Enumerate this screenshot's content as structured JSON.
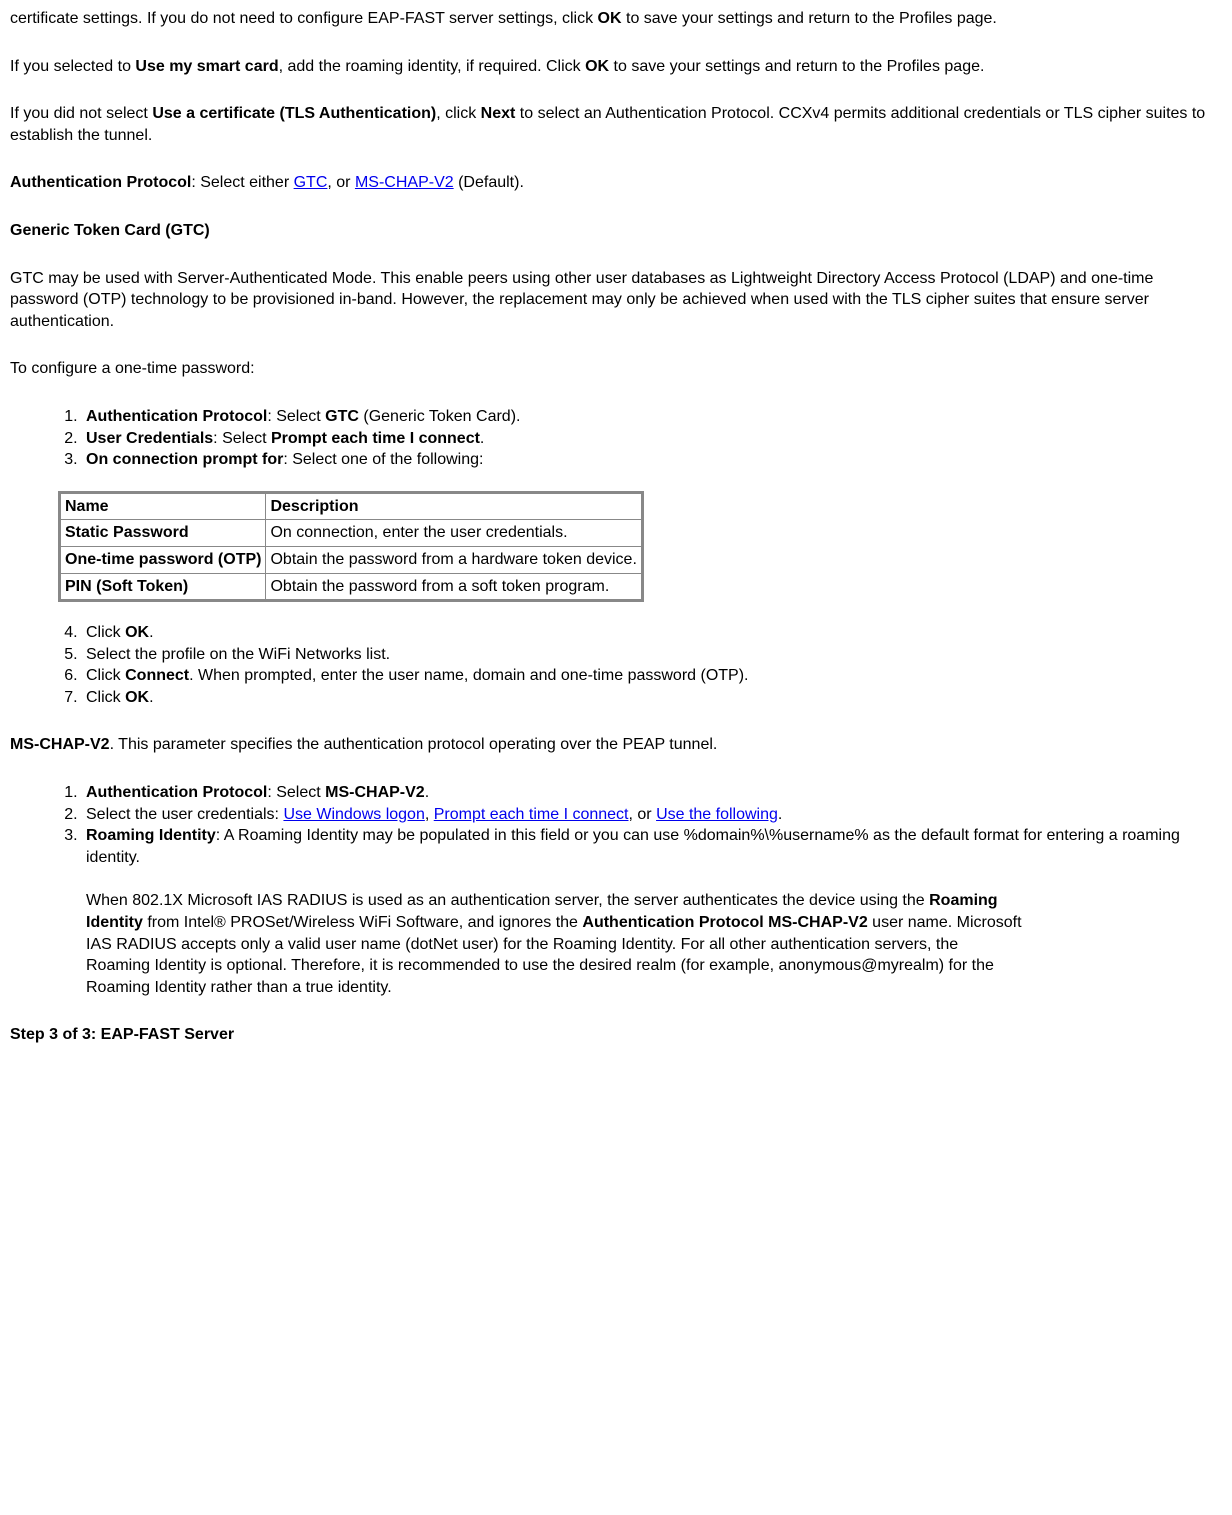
{
  "p1a": "certificate settings. If you do not need to configure EAP-FAST server settings, click ",
  "p1b": "OK",
  "p1c": " to save your settings and return to the Profiles page.",
  "p2a": "If you selected to ",
  "p2b": "Use my smart card",
  "p2c": ", add the roaming identity, if required. Click ",
  "p2d": "OK",
  "p2e": " to save your settings and return to the Profiles page.",
  "p3a": "If you did not select ",
  "p3b": "Use a certificate (TLS Authentication)",
  "p3c": ", click ",
  "p3d": "Next",
  "p3e": " to select an Authentication Protocol. CCXv4 permits additional credentials or TLS cipher suites to establish the tunnel.",
  "p4a": "Authentication Protocol",
  "p4b": ": Select either ",
  "p4_link1": "GTC",
  "p4c": ", or ",
  "p4_link2": "MS-CHAP-V2",
  "p4d": " (Default).",
  "h_gtc": "Generic Token Card (GTC)",
  "p5": "GTC may be used with Server-Authenticated Mode. This enable peers using other user databases as Lightweight Directory Access Protocol (LDAP) and one-time password (OTP) technology to be provisioned in-band. However, the replacement may only be achieved when used with the TLS cipher suites that ensure server authentication.",
  "p6": "To configure a one-time password:",
  "ol1": {
    "i1a": "Authentication Protocol",
    "i1b": ": Select ",
    "i1c": "GTC",
    "i1d": " (Generic Token Card).",
    "i2a": "User Credentials",
    "i2b": ": Select ",
    "i2c": "Prompt each time I connect",
    "i2d": ".",
    "i3a": "On connection prompt for",
    "i3b": ": Select one of the following:"
  },
  "table": {
    "h1": "Name",
    "h2": "Description",
    "r1c1": "Static Password",
    "r1c2": "On connection, enter the user credentials.",
    "r2c1": "One-time password (OTP)",
    "r2c2": "Obtain the password from a hardware token device.",
    "r3c1": "PIN (Soft Token)",
    "r3c2": "Obtain the password from a soft token program."
  },
  "ol2": {
    "i4a": "Click ",
    "i4b": "OK",
    "i4c": ".",
    "i5": "Select the profile on the WiFi Networks list.",
    "i6a": "Click ",
    "i6b": "Connect",
    "i6c": ". When prompted, enter the user name, domain and one-time password (OTP).",
    "i7a": "Click ",
    "i7b": "OK",
    "i7c": "."
  },
  "p7a": "MS-CHAP-V2",
  "p7b": ". This parameter specifies the authentication protocol operating over the PEAP tunnel.",
  "ol3": {
    "i1a": "Authentication Protocol",
    "i1b": ": Select ",
    "i1c": "MS-CHAP-V2",
    "i1d": ".",
    "i2a": "Select the user credentials: ",
    "i2_l1": "Use Windows logon",
    "i2b": ", ",
    "i2_l2": "Prompt each time I connect",
    "i2c": ", or ",
    "i2_l3": "Use the following",
    "i2d": ".",
    "i3a": "Roaming Identity",
    "i3b": ": A Roaming Identity may be populated in this field or you can use %domain%\\%username% as the default format for entering a roaming identity.",
    "i3p_a": "When 802.1X Microsoft IAS RADIUS is used as an authentication server, the server authenticates the device using the ",
    "i3p_b": "Roaming Identity",
    "i3p_c": " from Intel® PROSet/Wireless WiFi Software, and ignores the ",
    "i3p_d": "Authentication Protocol MS-CHAP-V2",
    "i3p_e": " user name. Microsoft IAS RADIUS accepts only a valid user name (dotNet user) for the Roaming Identity. For all other authentication servers, the Roaming Identity is optional. Therefore, it is recommended to use the desired realm (for example, anonymous@myrealm) for the Roaming Identity rather than a true identity."
  },
  "h_step3": "Step 3 of 3: EAP-FAST Server"
}
